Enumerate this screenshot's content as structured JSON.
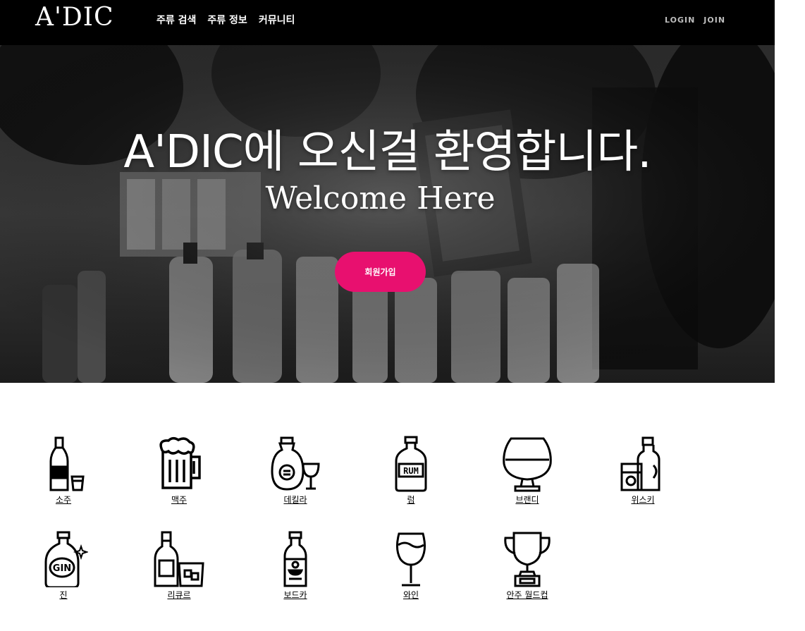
{
  "nav": {
    "logo": "A'DIC",
    "menu": [
      "주류 검색",
      "주류 정보",
      "커뮤니티"
    ],
    "login": "LOGIN",
    "join": "JOIN"
  },
  "hero": {
    "title": "A'DIC에 오신걸 환영합니다.",
    "subtitle": "Welcome Here",
    "signup_button": "회원가입",
    "accent_color": "#e8106f"
  },
  "categories": [
    {
      "label": "소주",
      "icon": "soju-bottle-icon"
    },
    {
      "label": "맥주",
      "icon": "beer-mug-icon"
    },
    {
      "label": "데킬라",
      "icon": "tequila-icon"
    },
    {
      "label": "럼",
      "icon": "rum-bottle-icon"
    },
    {
      "label": "브랜디",
      "icon": "brandy-glass-icon"
    },
    {
      "label": "위스키",
      "icon": "whiskey-icon"
    },
    {
      "label": "진",
      "icon": "gin-bottle-icon"
    },
    {
      "label": "리큐르",
      "icon": "liqueur-icon"
    },
    {
      "label": "보드카",
      "icon": "vodka-bottle-icon"
    },
    {
      "label": "와인",
      "icon": "wine-glass-icon"
    },
    {
      "label": "안주 월드컵",
      "icon": "trophy-icon"
    }
  ]
}
